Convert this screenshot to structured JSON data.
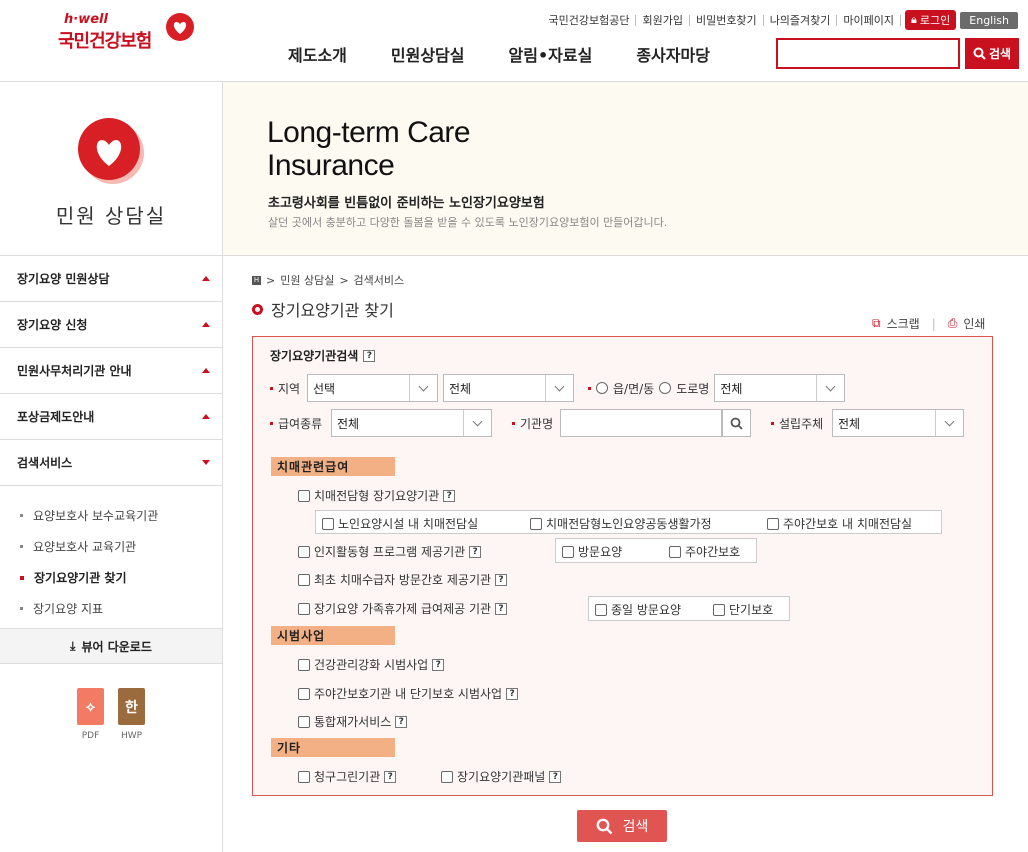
{
  "header": {
    "logo_top": "h·well",
    "logo_name": "국민건강보험",
    "util_links": [
      "국민건강보험공단",
      "회원가입",
      "비밀번호찾기",
      "나의즐겨찾기",
      "마이페이지"
    ],
    "login_label": "로그인",
    "english_label": "English",
    "gnb": [
      "제도소개",
      "민원상담실",
      "알림•자료실",
      "종사자마당"
    ],
    "search_value": "",
    "search_button": "검색"
  },
  "sidebar": {
    "title": "민원 상담실",
    "menu": [
      {
        "label": "장기요양 민원상담",
        "state": "collapsed"
      },
      {
        "label": "장기요양 신청",
        "state": "collapsed"
      },
      {
        "label": "민원사무처리기관 안내",
        "state": "collapsed"
      },
      {
        "label": "포상금제도안내",
        "state": "collapsed"
      },
      {
        "label": "검색서비스",
        "state": "expanded"
      }
    ],
    "submenu": [
      {
        "label": "요양보호사 보수교육기관"
      },
      {
        "label": "요양보호사 교육기관"
      },
      {
        "label": "장기요양기관 찾기"
      },
      {
        "label": "장기요양 지표"
      }
    ],
    "viewer_download": "뷰어 다운로드",
    "files": [
      {
        "label": "PDF",
        "glyph": "⟡"
      },
      {
        "label": "HWP",
        "glyph": "한"
      }
    ]
  },
  "banner": {
    "title_line1": "Long-term Care",
    "title_line2": "Insurance",
    "subtitle": "초고령사회를 빈틈없이 준비하는 노인장기요양보험",
    "desc": "살던 곳에서 충분하고 다양한 돌봄을 받을 수 있도록 노인장기요양보험이 만들어갑니다."
  },
  "breadcrumb": {
    "home": "H",
    "items": [
      "민원 상담실",
      "검색서비스"
    ]
  },
  "page_title": "장기요양기관 찾기",
  "tools": {
    "scrap": "스크랩",
    "print": "인쇄"
  },
  "form": {
    "heading": "장기요양기관검색",
    "help": "?",
    "region_label": "지역",
    "region_select1": "선택",
    "region_select2": "전체",
    "radio1": "읍/면/동",
    "radio2": "도로명",
    "region_select3": "전체",
    "benefit_label": "급여종류",
    "benefit_value": "전체",
    "org_label": "기관명",
    "org_value": "",
    "founder_label": "설립주체",
    "founder_value": "전체",
    "sections": {
      "dementia": "치매관련급여",
      "pilot": "시범사업",
      "etc": "기타"
    },
    "checks": {
      "c1": "치매전담형 장기요양기관",
      "c1a": "노인요양시설 내 치매전담실",
      "c1b": "치매전담형노인요양공동생활가정",
      "c1c": "주야간보호 내 치매전담실",
      "c2": "인지활동형 프로그램 제공기관",
      "c2a": "방문요양",
      "c2b": "주야간보호",
      "c3": "최초 치매수급자 방문간호 제공기관",
      "c4": "장기요양 가족휴가제 급여제공 기관",
      "c4a": "종일 방문요양",
      "c4b": "단기보호",
      "p1": "건강관리강화 시범사업",
      "p2": "주야간보호기관 내 단기보호 시범사업",
      "p3": "통합재가서비스",
      "e1": "청구그린기관",
      "e2": "장기요양기관패널"
    },
    "search_button": "검색"
  }
}
